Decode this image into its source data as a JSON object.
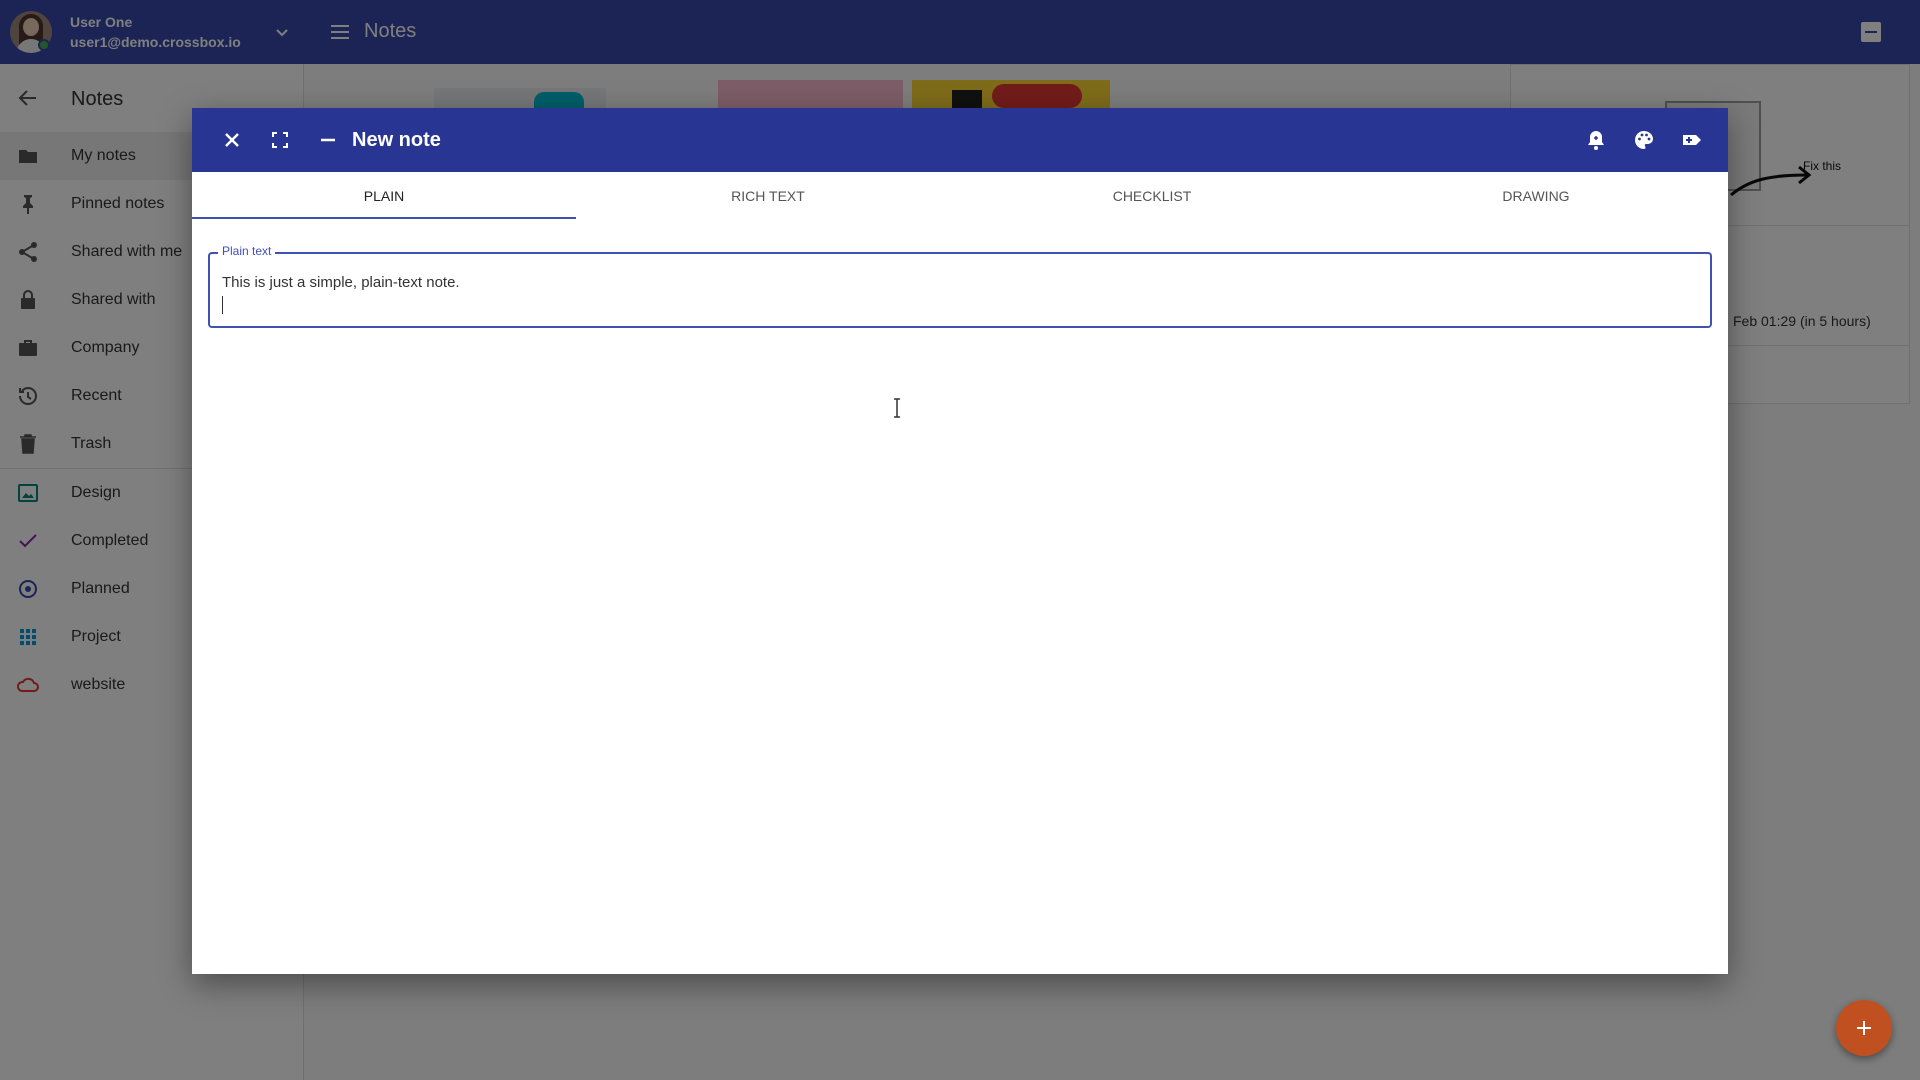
{
  "topbar": {
    "user_name": "User One",
    "user_email": "user1@demo.crossbox.io",
    "app_title": "Notes"
  },
  "sidebar": {
    "title": "Notes",
    "items": [
      {
        "label": "My notes",
        "icon": "folder-icon"
      },
      {
        "label": "Pinned notes",
        "icon": "pin-icon"
      },
      {
        "label": "Shared with me",
        "icon": "share-icon"
      },
      {
        "label": "Shared with",
        "icon": "lock-icon"
      },
      {
        "label": "Company",
        "icon": "briefcase-icon"
      },
      {
        "label": "Recent",
        "icon": "history-icon"
      },
      {
        "label": "Trash",
        "icon": "trash-icon"
      }
    ],
    "labels": [
      {
        "label": "Design",
        "icon": "image-icon",
        "color": "#00897b"
      },
      {
        "label": "Completed",
        "icon": "check-icon",
        "color": "#8e24aa"
      },
      {
        "label": "Planned",
        "icon": "radio-target-icon",
        "color": "#3949ab"
      },
      {
        "label": "Project",
        "icon": "grid-icon",
        "color": "#039be5"
      },
      {
        "label": "website",
        "icon": "cloud-icon",
        "color": "#e53935"
      }
    ]
  },
  "background": {
    "annotation": "Fix this",
    "reminder": "Feb 01:29  (in 5 hours)"
  },
  "dialog": {
    "title": "New note",
    "tabs": [
      "Plain",
      "Rich text",
      "Checklist",
      "Drawing"
    ],
    "active_tab": "Plain",
    "field_label": "Plain text",
    "field_value": "This is just a simple, plain-text note."
  },
  "colors": {
    "appbar": "#3949ab",
    "dialog_bar": "#283593",
    "accent": "#3f51b5",
    "fab": "#c0501f"
  }
}
